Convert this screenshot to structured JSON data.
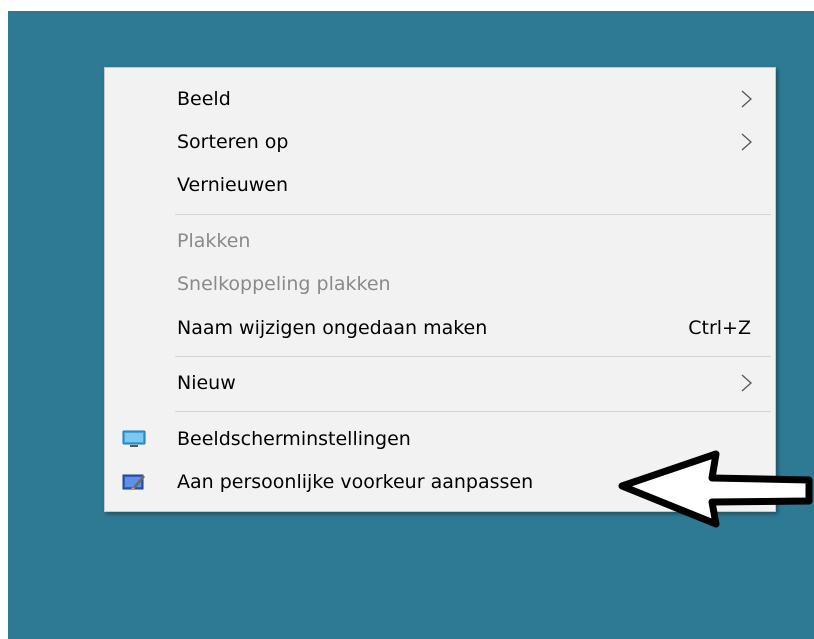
{
  "menu": {
    "items": [
      {
        "label": "Beeld"
      },
      {
        "label": "Sorteren op"
      },
      {
        "label": "Vernieuwen"
      },
      {
        "label": "Plakken"
      },
      {
        "label": "Snelkoppeling plakken"
      },
      {
        "label": "Naam wijzigen ongedaan maken",
        "shortcut": "Ctrl+Z"
      },
      {
        "label": "Nieuw"
      },
      {
        "label": "Beeldscherminstellingen",
        "icon": "display-settings-icon"
      },
      {
        "label": "Aan persoonlijke voorkeur aanpassen",
        "icon": "personalize-icon"
      }
    ]
  },
  "colors": {
    "desktop_background": "#2e7a94",
    "menu_background": "#f2f2f2",
    "disabled_text": "#8a8a8a"
  }
}
